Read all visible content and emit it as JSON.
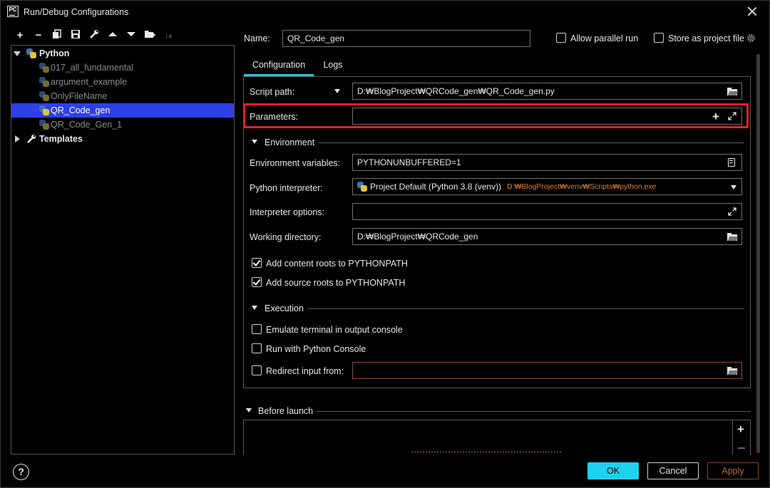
{
  "window": {
    "title": "Run/Debug Configurations",
    "app_icon_text": "PC"
  },
  "toolbar": {
    "icons": [
      "add-icon",
      "remove-icon",
      "copy-icon",
      "save-icon",
      "wrench-icon",
      "move-up-icon",
      "move-down-icon",
      "new-folder-icon",
      "sort-icon"
    ]
  },
  "tree": {
    "python_group": "Python",
    "items": [
      "017_all_fundamental",
      "argument_example",
      "OnlyFileName",
      "QR_Code_gen",
      "QR_Code_Gen_1"
    ],
    "selected_index": 3,
    "templates": "Templates"
  },
  "header": {
    "name_label": "Name:",
    "name_value": "QR_Code_gen",
    "allow_parallel_label": "Allow parallel run",
    "store_project_label": "Store as project file"
  },
  "tabs": [
    "Configuration",
    "Logs"
  ],
  "config": {
    "script_path_label": "Script path:",
    "script_path_value": "D:₩BlogProject₩QRCode_gen₩QR_Code_gen.py",
    "parameters_label": "Parameters:",
    "parameters_value": "",
    "environment_section": "Environment",
    "env_vars_label": "Environment variables:",
    "env_vars_value": "PYTHONUNBUFFERED=1",
    "interpreter_label": "Python interpreter:",
    "interpreter_value": "Project Default (Python 3.8 (venv))",
    "interpreter_path": "D:₩BlogProject₩venv₩Scripts₩python.exe",
    "interpreter_options_label": "Interpreter options:",
    "interpreter_options_value": "",
    "working_dir_label": "Working directory:",
    "working_dir_value": "D:₩BlogProject₩QRCode_gen",
    "content_roots_label": "Add content roots to PYTHONPATH",
    "content_roots_checked": true,
    "source_roots_label": "Add source roots to PYTHONPATH",
    "source_roots_checked": true,
    "execution_section": "Execution",
    "emulate_terminal_label": "Emulate terminal in output console",
    "python_console_label": "Run with Python Console",
    "redirect_input_label": "Redirect input from:",
    "redirect_input_value": ""
  },
  "before_launch": {
    "section": "Before launch"
  },
  "buttons": {
    "ok": "OK",
    "cancel": "Cancel",
    "apply": "Apply",
    "help": "?"
  },
  "colors": {
    "selection": "#2f40e6",
    "accent": "#26c6da",
    "ok_button": "#1fd1f0",
    "highlight": "#e0202a",
    "path_orange": "#d9822b"
  }
}
